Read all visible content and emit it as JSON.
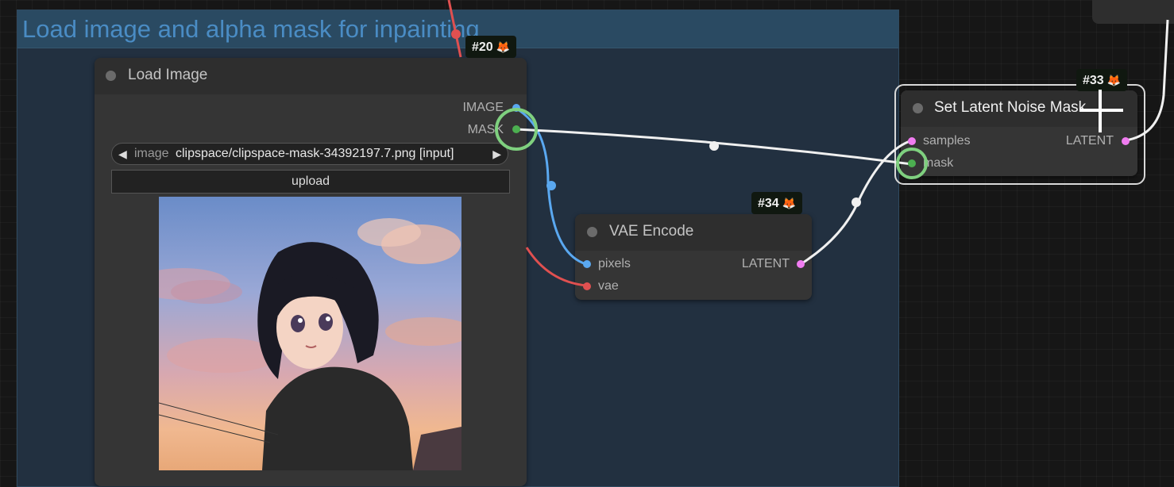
{
  "group": {
    "title": "Load image and alpha mask for inpainting"
  },
  "nodes": {
    "load_image": {
      "title": "Load Image",
      "badge": "#20",
      "outputs": [
        "IMAGE",
        "MASK"
      ],
      "image_widget": {
        "label": "image",
        "value": "clipspace/clipspace-mask-34392197.7.png [input]"
      },
      "upload_label": "upload"
    },
    "vae_encode": {
      "title": "VAE Encode",
      "badge": "#34",
      "inputs": [
        "pixels",
        "vae"
      ],
      "outputs": [
        "LATENT"
      ]
    },
    "set_latent_noise_mask": {
      "title": "Set Latent Noise Mask",
      "badge": "#33",
      "inputs": [
        "samples",
        "mask"
      ],
      "outputs": [
        "LATENT"
      ]
    }
  },
  "colors": {
    "image_slot": "#5aa8f0",
    "mask_slot": "#4caf50",
    "latent_slot": "#f07cf0",
    "vae_slot": "#e05050",
    "link_white": "#f0f0f0",
    "link_blue": "#5aa8f0",
    "link_red": "#e05050",
    "highlight_ring": "#7fd07f"
  },
  "icons": [
    "fox-badge-icon",
    "left-arrow-icon",
    "right-arrow-icon",
    "crosshair-cursor-icon"
  ]
}
